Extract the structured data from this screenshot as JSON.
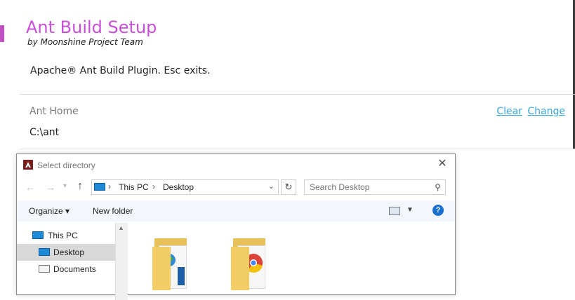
{
  "header": {
    "title": "Ant Build Setup",
    "byline": "by Moonshine Project Team",
    "description": "Apache® Ant Build Plugin. Esc exits."
  },
  "ant_home": {
    "label": "Ant Home",
    "value": "C:\\ant",
    "clear_label": "Clear",
    "change_label": "Change"
  },
  "dialog": {
    "title": "Select directory",
    "close_glyph": "✕",
    "nav": {
      "back_glyph": "←",
      "forward_glyph": "→",
      "recent_glyph": "▾",
      "up_glyph": "↑"
    },
    "address": {
      "parts": [
        "This PC",
        "Desktop"
      ],
      "separator": "›",
      "dropdown_glyph": "⌄"
    },
    "refresh_glyph": "↻",
    "search": {
      "placeholder": "Search Desktop",
      "icon_glyph": "⚲"
    },
    "toolbar": {
      "organize_label": "Organize ▾",
      "new_folder_label": "New folder",
      "view_dropdown_glyph": "▼",
      "help_glyph": "?"
    },
    "nav_pane": {
      "items": [
        {
          "label": "This PC",
          "icon": "monitor-icon"
        },
        {
          "label": "Desktop",
          "icon": "desktop-icon",
          "selected": true
        },
        {
          "label": "Documents",
          "icon": "documents-icon"
        }
      ]
    },
    "scroll_up_glyph": "▲",
    "folders": [
      {
        "icon": "folder-web-icon"
      },
      {
        "icon": "folder-chrome-icon"
      }
    ]
  },
  "colors": {
    "title": "#c84fd8",
    "link": "#3aa6e0",
    "accent_bar": "#c150c2"
  }
}
